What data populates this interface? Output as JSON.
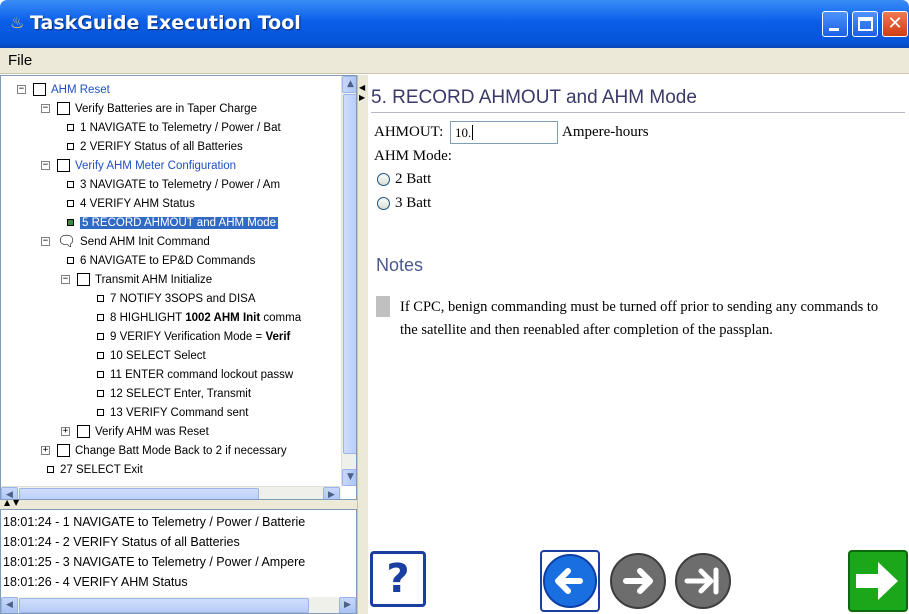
{
  "window": {
    "title": "TaskGuide Execution Tool"
  },
  "menu": {
    "file": "File"
  },
  "tree": [
    {
      "id": "n1",
      "indent": 0,
      "expander": "minus",
      "box": "check",
      "label": "AHM Reset",
      "style": "blue"
    },
    {
      "id": "n2",
      "indent": 1,
      "expander": "minus",
      "box": "check",
      "label": "Verify Batteries are in Taper Charge",
      "style": ""
    },
    {
      "id": "n3",
      "indent": 2,
      "expander": "",
      "box": "square",
      "label": "1 NAVIGATE to Telemetry / Power / Bat",
      "style": ""
    },
    {
      "id": "n4",
      "indent": 2,
      "expander": "",
      "box": "square",
      "label": "2 VERIFY Status of all Batteries",
      "style": ""
    },
    {
      "id": "n5",
      "indent": 1,
      "expander": "minus",
      "box": "check",
      "label": "Verify AHM Meter Configuration",
      "style": "blue"
    },
    {
      "id": "n6",
      "indent": 2,
      "expander": "",
      "box": "square",
      "label": "3 NAVIGATE to Telemetry / Power / Am",
      "style": ""
    },
    {
      "id": "n7",
      "indent": 2,
      "expander": "",
      "box": "square",
      "label": "4 VERIFY AHM Status",
      "style": ""
    },
    {
      "id": "n8",
      "indent": 2,
      "expander": "",
      "box": "square-green",
      "label": "5 RECORD AHMOUT and AHM Mode",
      "style": "selected"
    },
    {
      "id": "n9",
      "indent": 1,
      "expander": "minus",
      "box": "cycle",
      "label": "Send AHM Init Command",
      "style": ""
    },
    {
      "id": "n10",
      "indent": 2,
      "expander": "",
      "box": "square",
      "label": "6 NAVIGATE to EP&D Commands",
      "style": ""
    },
    {
      "id": "n11",
      "indent": 2,
      "expander": "minus",
      "box": "check",
      "label": "Transmit AHM Initialize",
      "style": ""
    },
    {
      "id": "n12",
      "indent": 3,
      "expander": "",
      "box": "square",
      "label": "7 NOTIFY 3SOPS and DISA",
      "style": ""
    },
    {
      "id": "n13",
      "indent": 3,
      "expander": "",
      "box": "square",
      "label_pre": "8 HIGHLIGHT ",
      "label_bold": "1002 AHM Init",
      "label_post": " comma",
      "style": "rich"
    },
    {
      "id": "n14",
      "indent": 3,
      "expander": "",
      "box": "square",
      "label_pre": "9 VERIFY Verification Mode = ",
      "label_bold": "Verif",
      "label_post": "",
      "style": "rich"
    },
    {
      "id": "n15",
      "indent": 3,
      "expander": "",
      "box": "square",
      "label": "10 SELECT Select",
      "style": ""
    },
    {
      "id": "n16",
      "indent": 3,
      "expander": "",
      "box": "square",
      "label": "11 ENTER command lockout passw",
      "style": ""
    },
    {
      "id": "n17",
      "indent": 3,
      "expander": "",
      "box": "square",
      "label": "12 SELECT Enter, Transmit",
      "style": ""
    },
    {
      "id": "n18",
      "indent": 3,
      "expander": "",
      "box": "square",
      "label": "13 VERIFY Command sent",
      "style": ""
    },
    {
      "id": "n19",
      "indent": 2,
      "expander": "plus",
      "box": "check",
      "label": "Verify AHM was Reset",
      "style": ""
    },
    {
      "id": "n20",
      "indent": 1,
      "expander": "plus",
      "box": "check",
      "label": "Change Batt Mode Back to 2 if necessary",
      "style": ""
    },
    {
      "id": "n21",
      "indent": 1,
      "expander": "",
      "box": "square",
      "label": "27 SELECT Exit",
      "style": ""
    }
  ],
  "log": [
    "18:01:24 - 1 NAVIGATE to Telemetry / Power / Batterie",
    "18:01:24 - 2 VERIFY Status of all Batteries",
    "18:01:25 - 3 NAVIGATE to Telemetry / Power / Ampere",
    "18:01:26 - 4 VERIFY AHM Status"
  ],
  "step": {
    "title": "5. RECORD AHMOUT and AHM Mode",
    "ahmout_label": "AHMOUT:",
    "ahmout_value": "10.",
    "ahmout_units": "Ampere-hours",
    "mode_label": "AHM Mode:",
    "mode_options": [
      "2 Batt",
      "3 Batt"
    ]
  },
  "notes": {
    "heading": "Notes",
    "text": "If CPC, benign commanding must be turned off prior to sending any commands to the satellite and then reenabled after completion of the passplan."
  },
  "buttons": {
    "help": "?"
  },
  "colors": {
    "titlebar": "#0653d6",
    "selection": "#316ac5",
    "nav_blue": "#1a6fe0",
    "nav_gray": "#6d6d6d",
    "next_green": "#1aa81a",
    "link_blue": "#2050c0"
  }
}
